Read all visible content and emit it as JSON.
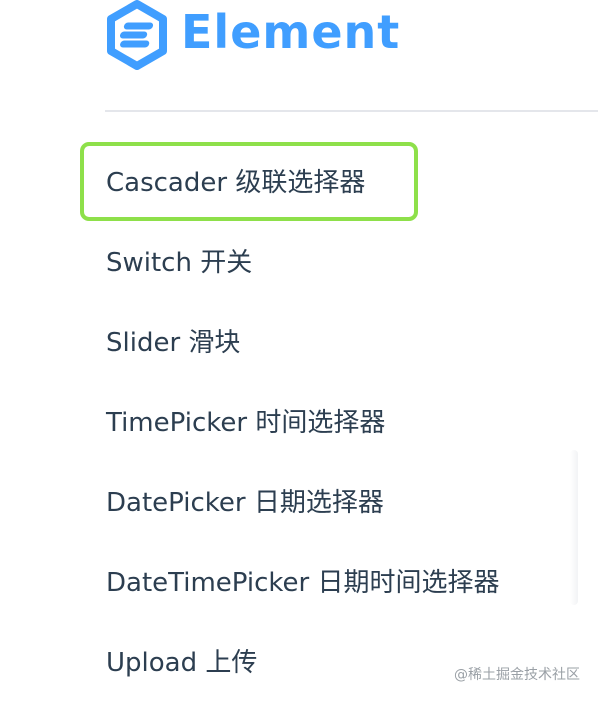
{
  "logo": {
    "icon": "element-logo-icon",
    "text": "Element",
    "color": "#409eff"
  },
  "menu": {
    "items": [
      {
        "label": "Cascader 级联选择器",
        "active": true
      },
      {
        "label": "Switch 开关"
      },
      {
        "label": "Slider 滑块"
      },
      {
        "label": "TimePicker 时间选择器"
      },
      {
        "label": "DatePicker 日期选择器"
      },
      {
        "label": "DateTimePicker 日期时间选择器"
      },
      {
        "label": "Upload 上传"
      }
    ]
  },
  "highlight_color": "#8ee04a",
  "text_color": "#2c3e50",
  "watermark": "@稀土掘金技术社区"
}
